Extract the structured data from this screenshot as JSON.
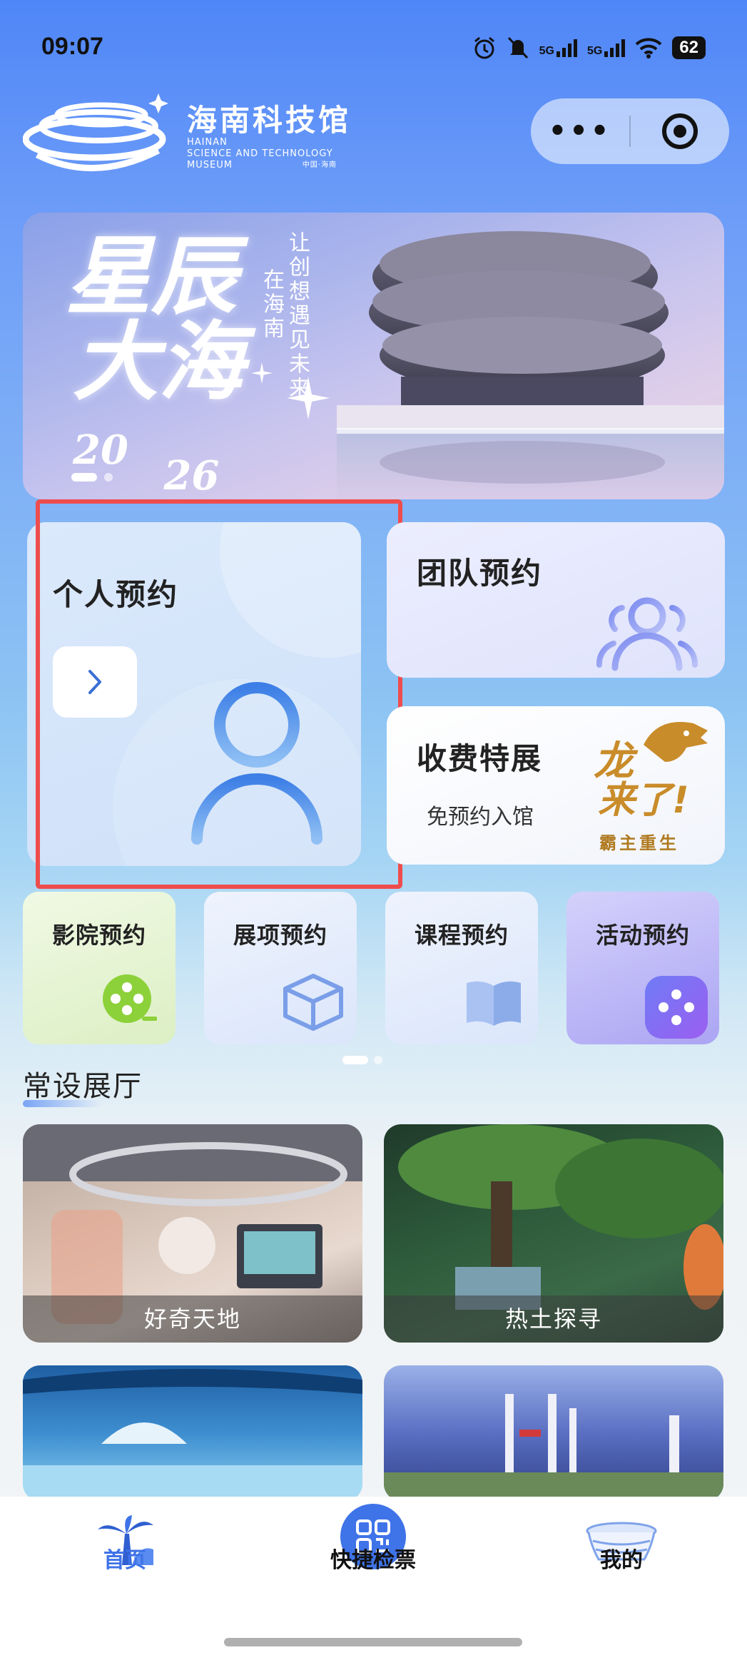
{
  "status_bar": {
    "time": "09:07",
    "network_1": "5G",
    "network_2": "5G",
    "battery": "62",
    "icons": [
      "alarm-icon",
      "mute-icon",
      "signal-icon",
      "signal-icon",
      "wifi-icon",
      "battery-icon"
    ]
  },
  "header": {
    "logo_cn": "海南科技馆",
    "logo_en_line1": "HAINAN",
    "logo_en_line2": "SCIENCE AND TECHNOLOGY",
    "logo_en_line3": "MUSEUM",
    "logo_small": "中国·海南"
  },
  "capsule": {
    "more_icon": "more-dots-icon",
    "close_icon": "target-icon"
  },
  "banner": {
    "title_line1": "星辰",
    "title_line2": "大海",
    "year_a": "20",
    "year_b": "26",
    "slogan_1": "在海南",
    "slogan_2": "让创想遇见未来",
    "slides": 3,
    "active_slide": 1
  },
  "booking": {
    "personal": {
      "title": "个人预约",
      "icon": "person-icon"
    },
    "team": {
      "title": "团队预约",
      "icon": "group-icon"
    },
    "paid": {
      "title": "收费特展",
      "subtitle": "免预约入馆",
      "poster_line1": "龙",
      "poster_line2": "来了!",
      "poster_line3": "霸主重生"
    }
  },
  "quick": [
    {
      "title": "影院预约",
      "icon": "film-reel-icon",
      "color": "#e6f4cf"
    },
    {
      "title": "展项预约",
      "icon": "box-icon",
      "color": "#e3ecfb"
    },
    {
      "title": "课程预约",
      "icon": "book-icon",
      "color": "#e3ecfb"
    },
    {
      "title": "活动预约",
      "icon": "game-controller-icon",
      "color": "#b9b4f6"
    }
  ],
  "section": {
    "title": "常设展厅"
  },
  "halls": [
    {
      "name": "好奇天地"
    },
    {
      "name": "热土探寻"
    },
    {
      "name": ""
    },
    {
      "name": ""
    }
  ],
  "nav": {
    "home": "首页",
    "ticket": "快捷检票",
    "mine": "我的",
    "active": "home",
    "active_color": "#3f73e8"
  }
}
